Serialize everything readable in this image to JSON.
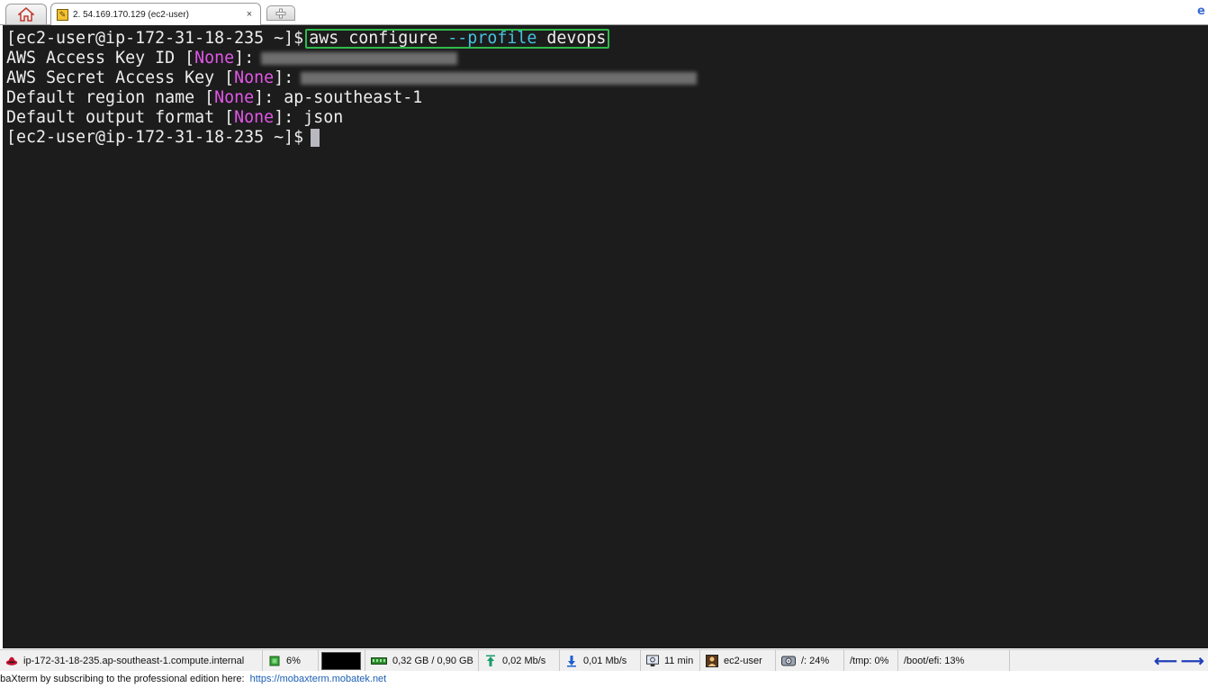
{
  "tabs": {
    "home_icon": "home-icon",
    "session_tab_title": "2. 54.169.170.129 (ec2-user)",
    "close_glyph": "×",
    "new_tab_icon": "plus-icon"
  },
  "terminal": {
    "prompt": "[ec2-user@ip-172-31-18-235 ~]$",
    "command_part1": "aws configure",
    "command_flag": "--profile",
    "command_part2": "devops",
    "lines": [
      {
        "label": "AWS Access Key ID ",
        "bracket_open": "[",
        "default": "None",
        "bracket_close": "]",
        "suffix": ":",
        "value": ""
      },
      {
        "label": "AWS Secret Access Key ",
        "bracket_open": "[",
        "default": "None",
        "bracket_close": "]",
        "suffix": ":",
        "value": ""
      },
      {
        "label": "Default region name ",
        "bracket_open": "[",
        "default": "None",
        "bracket_close": "]",
        "suffix": ":",
        "value": "ap-southeast-1"
      },
      {
        "label": "Default output format ",
        "bracket_open": "[",
        "default": "None",
        "bracket_close": "]",
        "suffix": ":",
        "value": "json"
      }
    ],
    "colors": {
      "background": "#1c1c1c",
      "text": "#ededed",
      "default_highlight": "#e156e8",
      "flag_highlight": "#46c2e0",
      "command_box": "#2fba4b"
    }
  },
  "statusbar": {
    "hostname": "ip-172-31-18-235.ap-southeast-1.compute.internal",
    "cpu": "6%",
    "memory": "0,32 GB / 0,90 GB",
    "upload": "0,02 Mb/s",
    "download": "0,01 Mb/s",
    "uptime": "11 min",
    "user": "ec2-user",
    "disk_root": "/: 24%",
    "disk_tmp": "/tmp: 0%",
    "disk_boot": "/boot/efi: 13%"
  },
  "footer": {
    "message": "obaXterm by subscribing to the professional edition here:",
    "link": "https://mobaxterm.mobatek.net"
  }
}
